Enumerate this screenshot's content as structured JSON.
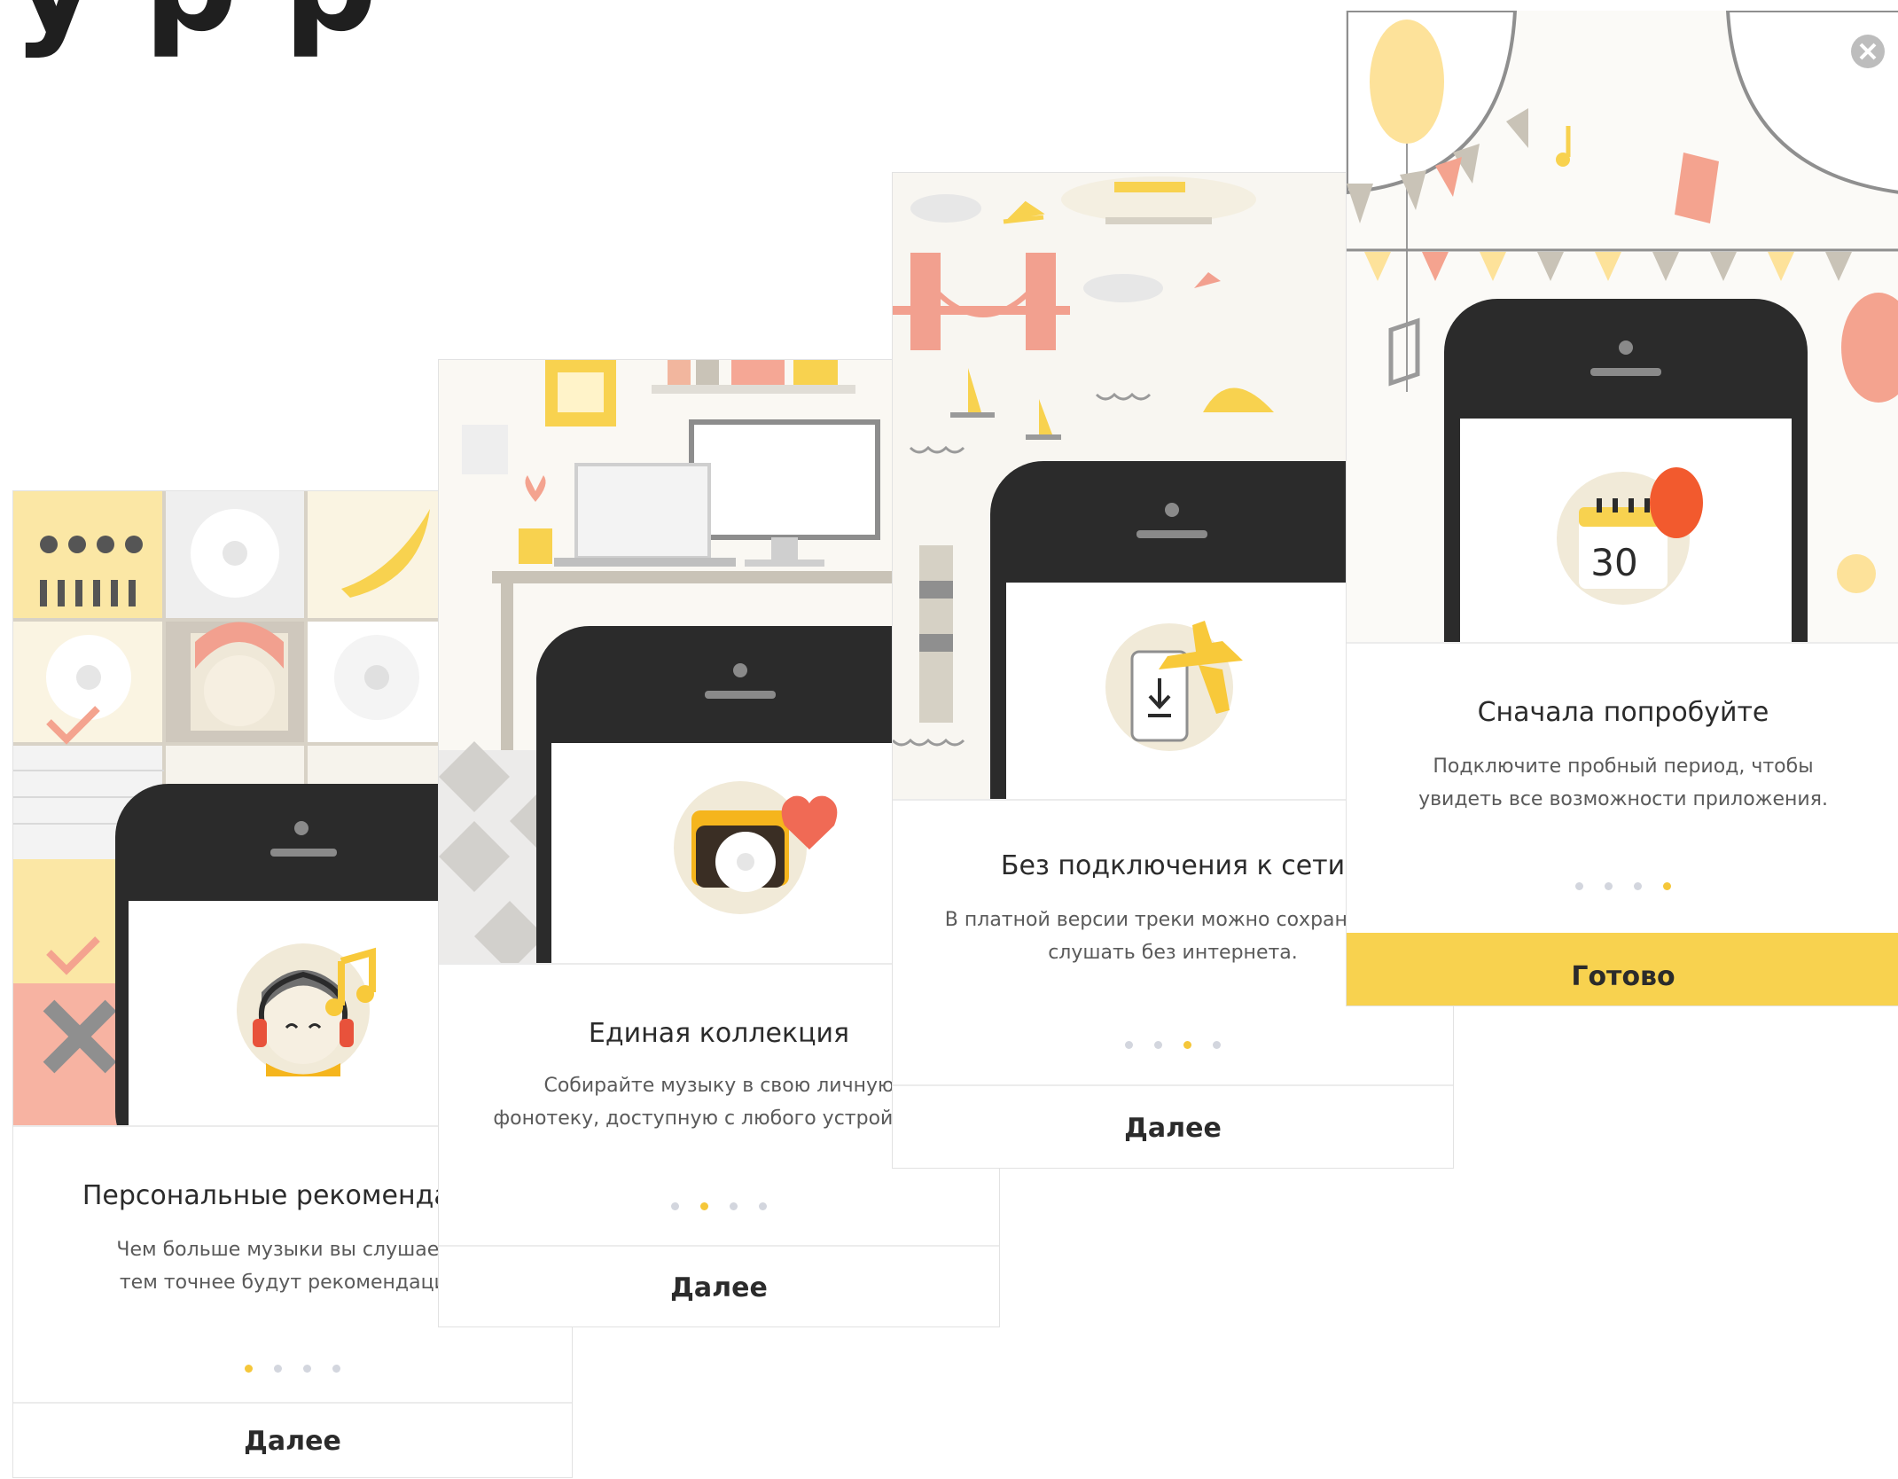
{
  "header": {
    "title_fragment": "у    р   р"
  },
  "cards": [
    {
      "title": "Персональные рекомендации",
      "desc_line1": "Чем больше музыки вы слушаете,",
      "desc_line2": "тем точнее будут рекомендации.",
      "active_dot": 1,
      "button": "Далее"
    },
    {
      "title": "Единая коллекция",
      "desc_line1": "Собирайте музыку в свою личную",
      "desc_line2": "фонотеку, доступную с любого устройства.",
      "active_dot": 2,
      "button": "Далее"
    },
    {
      "title": "Без подключения к сети",
      "desc_line1": "В платной версии треки можно сохранять и",
      "desc_line2": "слушать без интернета.",
      "active_dot": 3,
      "button": "Далее"
    },
    {
      "title": "Сначала попробуйте",
      "desc_line1": "Подключите пробный период, чтобы",
      "desc_line2": "увидеть все возможности приложения.",
      "active_dot": 4,
      "button": "Готово",
      "calendar_day": "30"
    }
  ],
  "colors": {
    "accent_yellow": "#f8d24f",
    "dot_active": "#f5c73a",
    "dot_inactive": "#d3d6de",
    "phone_black": "#2b2b2b",
    "heart_red": "#f06a55",
    "balloon_red": "#f25a2e"
  }
}
